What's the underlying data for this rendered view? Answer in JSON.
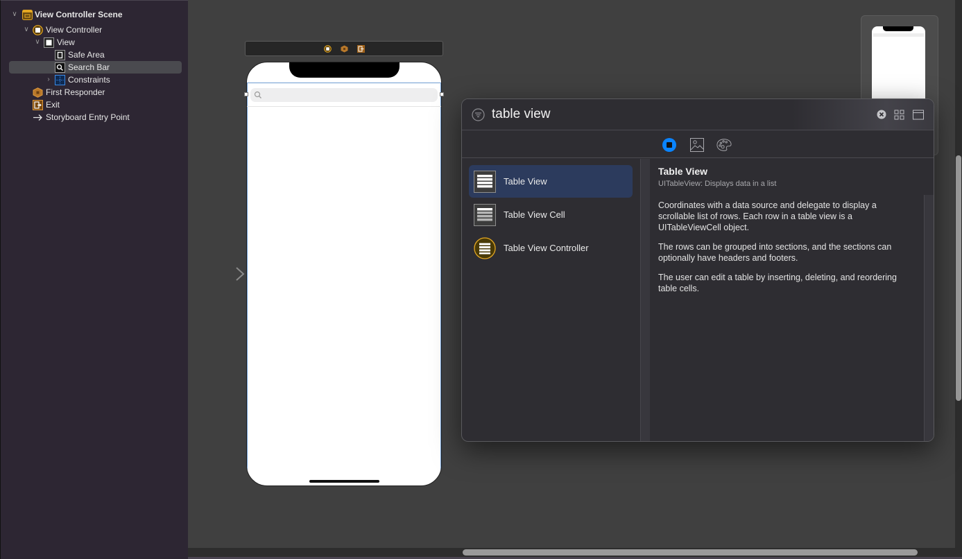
{
  "outline": {
    "items": [
      {
        "label": "View Controller Scene",
        "expanded": true
      },
      {
        "label": "View Controller",
        "expanded": true
      },
      {
        "label": "View",
        "expanded": true
      },
      {
        "label": "Safe Area"
      },
      {
        "label": "Search Bar",
        "selected": true
      },
      {
        "label": "Constraints",
        "expanded": false
      },
      {
        "label": "First Responder"
      },
      {
        "label": "Exit"
      },
      {
        "label": "Storyboard Entry Point"
      }
    ]
  },
  "canvas": {
    "scene_dock_icons": [
      "view-controller-icon",
      "first-responder-icon",
      "exit-icon"
    ]
  },
  "library": {
    "search": {
      "value": "table view",
      "placeholder": "Filter"
    },
    "tabs": [
      {
        "name": "objects",
        "active": true
      },
      {
        "name": "media",
        "active": false
      },
      {
        "name": "colors",
        "active": false
      }
    ],
    "results": [
      {
        "label": "Table View",
        "selected": true
      },
      {
        "label": "Table View Cell",
        "selected": false
      },
      {
        "label": "Table View Controller",
        "selected": false
      }
    ],
    "detail": {
      "title": "Table View",
      "subtitle": "UITableView: Displays data in a list",
      "paragraphs": [
        "Coordinates with a data source and delegate to display a scrollable list of rows. Each row in a table view is a UITableViewCell object.",
        "The rows can be grouped into sections, and the sections can optionally have headers and footers.",
        "The user can edit a table by inserting, deleting, and reordering table cells."
      ]
    }
  },
  "colors": {
    "accent": "#0a84ff",
    "controller_yellow": "#e5a823",
    "selection": "#2c3b5d"
  }
}
